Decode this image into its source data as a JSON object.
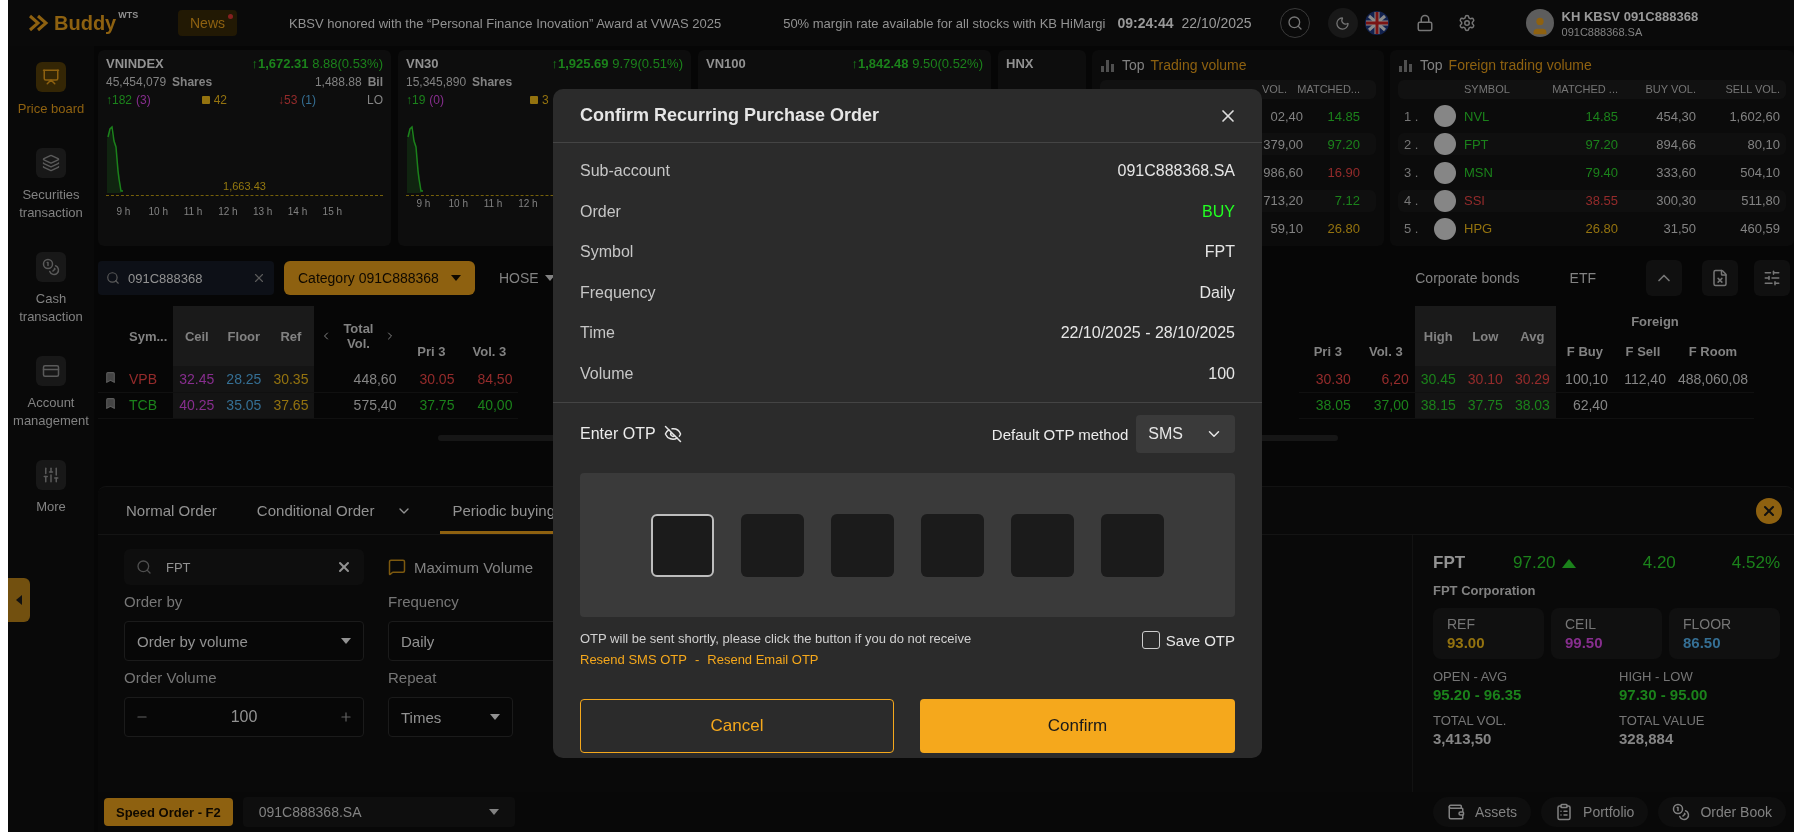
{
  "header": {
    "logo": "Buddy",
    "logo_tag": "WTS",
    "news": "News",
    "tickers": [
      "KBSV honored with the “Personal Finance Inovation” Award at VWAS 2025",
      "50% margin rate available for all stocks with KB HiMargi"
    ],
    "time": "09:24:44",
    "date": "22/10/2025",
    "user": {
      "name": "KH KBSV 091C888368",
      "account": "091C888368.SA"
    }
  },
  "sidebar": [
    {
      "label": "Price board",
      "kind": "board",
      "selected": true
    },
    {
      "label": "Securities transaction",
      "kind": "securities",
      "selected": false
    },
    {
      "label": "Cash transaction",
      "kind": "cash",
      "selected": false
    },
    {
      "label": "Account management",
      "kind": "account",
      "selected": false
    },
    {
      "label": "More",
      "kind": "more",
      "selected": false
    }
  ],
  "indices": [
    {
      "name": "VNINDEX",
      "value": "↑1,672.31",
      "change": "8.88(0.53%)",
      "shares": "45,454,079",
      "shares_unit": "Shares",
      "traded": "1,488.88",
      "traded_unit": "Bil",
      "breadth": [
        [
          {
            "text": "↑182",
            "color": "#1b821b",
            "kind": "count"
          },
          {
            "text": "(3)",
            "color": "#872e8e",
            "kind": "count"
          }
        ],
        [
          {
            "text": "42",
            "color": "#94730f",
            "kind": "flat"
          }
        ],
        [
          {
            "text": "↓53",
            "color": "#942b2b",
            "kind": "count"
          },
          {
            "text": "(1)",
            "color": "#356f94",
            "kind": "count"
          }
        ],
        [
          {
            "text": "LO",
            "color": "#858585",
            "kind": "count"
          }
        ]
      ],
      "chart": {
        "ref_label": "1,663.43",
        "times": [
          "9 h",
          "10 h",
          "11 h",
          "12 h",
          "13 h",
          "14 h",
          "15 h"
        ]
      }
    },
    {
      "name": "VN30",
      "value": "↑1,925.69",
      "change": "9.79(0.51%)",
      "shares": "15,345,890",
      "shares_unit": "Shares",
      "breadth": [
        [
          {
            "text": "↑19",
            "color": "#1b821b",
            "kind": "count"
          },
          {
            "text": "(0)",
            "color": "#872e8e",
            "kind": "count"
          }
        ],
        [
          {
            "text": "3",
            "color": "#94730f",
            "kind": "flat"
          }
        ]
      ],
      "chart": {
        "times": [
          "9 h",
          "10 h",
          "11 h",
          "12 h"
        ]
      }
    },
    {
      "name": "VN100",
      "value": "↑1,842.48",
      "change": "9.50(0.52%)"
    },
    {
      "name": "HNX"
    }
  ],
  "top_trading": {
    "prefix": "Top",
    "title": "Trading volume",
    "columns": [
      "VOL.",
      "MATCHED..."
    ],
    "rows": [
      {
        "vol": "02,40",
        "matched": "14.85",
        "color": "#1b821b"
      },
      {
        "vol": "379,00",
        "matched": "97.20",
        "color": "#1b821b"
      },
      {
        "vol": "986,60",
        "matched": "16.90",
        "color": "#942b2b"
      },
      {
        "vol": "713,20",
        "matched": "7.12",
        "color": "#1b821b"
      },
      {
        "vol": "59,10",
        "matched": "26.80",
        "color": "#94730f"
      }
    ]
  },
  "top_foreign": {
    "prefix": "Top",
    "title": "Foreign trading volume",
    "columns": [
      "SYMBOL",
      "MATCHED ...",
      "BUY VOL.",
      "SELL VOL."
    ],
    "rows": [
      {
        "rank": "1 .",
        "symbol": "NVL",
        "matched": "14.85",
        "buy": "454,30",
        "sell": "1,602,60",
        "color": "#1b821b"
      },
      {
        "rank": "2 .",
        "symbol": "FPT",
        "matched": "97.20",
        "buy": "894,66",
        "sell": "80,10",
        "color": "#1b821b"
      },
      {
        "rank": "3 .",
        "symbol": "MSN",
        "matched": "79.40",
        "buy": "333,60",
        "sell": "504,10",
        "color": "#1b821b"
      },
      {
        "rank": "4 .",
        "symbol": "SSI",
        "matched": "38.55",
        "buy": "300,30",
        "sell": "511,80",
        "color": "#942b2b"
      },
      {
        "rank": "5 .",
        "symbol": "HPG",
        "matched": "26.80",
        "buy": "31,50",
        "sell": "460,59",
        "color": "#94730f"
      }
    ]
  },
  "board": {
    "search": "091C888368",
    "category": "Category 091C888368",
    "exchange": "HOSE",
    "tabs": [
      {
        "label": "Corporate bonds",
        "selected": false
      },
      {
        "label": "ETF",
        "selected": false
      }
    ],
    "left_columns": [
      {
        "label": "Sym...",
        "shaded": false
      },
      {
        "label": "Ceil",
        "shaded": true
      },
      {
        "label": "Floor",
        "shaded": true
      },
      {
        "label": "Ref",
        "shaded": true
      },
      {
        "label": "Total Vol.",
        "shaded": false,
        "arrows": true
      },
      {
        "columns": [
          "Pri 3",
          "Vol. 3"
        ]
      }
    ],
    "left_rows": [
      [
        {
          "text": "VPB",
          "color": "#942b2b"
        },
        {
          "text": "32.45",
          "color": "#872e8e"
        },
        {
          "text": "28.25",
          "color": "#356f94"
        },
        {
          "text": "30.35",
          "color": "#94730f"
        },
        {
          "text": "448,60",
          "color": "#858585"
        },
        {
          "text": "30.05",
          "color": "#942b2b"
        },
        {
          "text": "84,50",
          "color": "#942b2b"
        }
      ],
      [
        {
          "text": "TCB",
          "color": "#1b821b"
        },
        {
          "text": "40.25",
          "color": "#872e8e"
        },
        {
          "text": "35.05",
          "color": "#356f94"
        },
        {
          "text": "37.65",
          "color": "#94730f"
        },
        {
          "text": "575,40",
          "color": "#858585"
        },
        {
          "text": "37.75",
          "color": "#1b821b"
        },
        {
          "text": "40,00",
          "color": "#1b821b"
        }
      ]
    ],
    "right_columns": [
      {
        "columns": [
          "Pri 3",
          "Vol. 3"
        ]
      },
      {
        "label": "High",
        "shaded": true
      },
      {
        "label": "Low",
        "shaded": true
      },
      {
        "label": "Avg",
        "shaded": true
      },
      {
        "group": "Foreign",
        "columns": [
          "F Buy",
          "F Sell",
          "F Room"
        ]
      }
    ],
    "right_rows": [
      [
        {
          "text": "30.30",
          "color": "#942b2b"
        },
        {
          "text": "6,20",
          "color": "#942b2b"
        },
        {
          "text": "30.45",
          "color": "#1b821b"
        },
        {
          "text": "30.10",
          "color": "#942b2b"
        },
        {
          "text": "30.29",
          "color": "#942b2b"
        },
        {
          "text": "100,10",
          "color": "#858585"
        },
        {
          "text": "112,40",
          "color": "#858585"
        },
        {
          "text": "488,060,08",
          "color": "#858585"
        }
      ],
      [
        {
          "text": "38.05",
          "color": "#1b821b"
        },
        {
          "text": "37,00",
          "color": "#1b821b"
        },
        {
          "text": "38.15",
          "color": "#1b821b"
        },
        {
          "text": "37.75",
          "color": "#1b821b"
        },
        {
          "text": "38.03",
          "color": "#1b821b"
        },
        {
          "text": "62,40",
          "color": "#858585"
        },
        null,
        null
      ]
    ]
  },
  "order": {
    "tabs": [
      {
        "label": "Normal Order",
        "selected": false,
        "dropdown": false
      },
      {
        "label": "Conditional Order",
        "selected": false,
        "dropdown": true
      },
      {
        "label": "Periodic buying",
        "selected": true,
        "dropdown": false
      }
    ],
    "search": "FPT",
    "max_volume": "Maximum Volume",
    "order_by": {
      "label": "Order by",
      "value": "Order by volume"
    },
    "frequency": {
      "label": "Frequency",
      "value": "Daily"
    },
    "order_volume": {
      "label": "Order Volume",
      "value": "100"
    },
    "repeat": {
      "label": "Repeat",
      "value": "Times"
    }
  },
  "detail": {
    "symbol": "FPT",
    "price": "97.20",
    "change": "4.20",
    "percent": "4.52%",
    "company": "FPT Corporation",
    "boxes": [
      {
        "label": "REF",
        "value": "93.00",
        "color": "#94730f"
      },
      {
        "label": "CEIL",
        "value": "99.50",
        "color": "#872e8e"
      },
      {
        "label": "FLOOR",
        "value": "86.50",
        "color": "#356f94"
      }
    ],
    "stats": [
      {
        "label": "OPEN - AVG",
        "value": "95.20 - 96.35",
        "color": "#1b821b"
      },
      {
        "label": "HIGH - LOW",
        "value": "97.30 - 95.00",
        "color": "#1b821b"
      },
      {
        "label": "TOTAL VOL.",
        "value": "3,413,50",
        "color": "#858585"
      },
      {
        "label": "TOTAL VALUE",
        "value": "328,884",
        "color": "#858585"
      }
    ]
  },
  "bottom_bar": {
    "speed_order": "Speed Order - F2",
    "account": "091C888368.SA",
    "actions": [
      {
        "label": "Assets",
        "kind": "wallet"
      },
      {
        "label": "Portfolio",
        "kind": "clipboard"
      },
      {
        "label": "Order Book",
        "kind": "coins"
      }
    ]
  },
  "modal": {
    "title": "Confirm Recurring Purchase Order",
    "rows": [
      {
        "label": "Sub-account",
        "value": "091C888368.SA",
        "color": "#e6e6e6"
      },
      {
        "label": "Order",
        "value": "BUY",
        "color": "#22ff22"
      },
      {
        "label": "Symbol",
        "value": "FPT",
        "color": "#e6e6e6"
      },
      {
        "label": "Frequency",
        "value": "Daily",
        "color": "#e6e6e6"
      },
      {
        "label": "Time",
        "value": "22/10/2025 - 28/10/2025",
        "color": "#e6e6e6"
      },
      {
        "label": "Volume",
        "value": "100",
        "color": "#e6e6e6"
      }
    ],
    "otp_label": "Enter OTP",
    "method_label": "Default OTP method",
    "method": "SMS",
    "otp_boxes": [
      {
        "focused": true
      },
      {
        "focused": false
      },
      {
        "focused": false
      },
      {
        "focused": false
      },
      {
        "focused": false
      },
      {
        "focused": false
      }
    ],
    "hint": "OTP will be sent shortly, please click the button if you do not receive",
    "resend_sms": "Resend SMS OTP",
    "separator": "-",
    "resend_email": "Resend Email OTP",
    "save_otp": {
      "label": "Save OTP",
      "checked": false
    },
    "cancel": "Cancel",
    "confirm": "Confirm"
  }
}
